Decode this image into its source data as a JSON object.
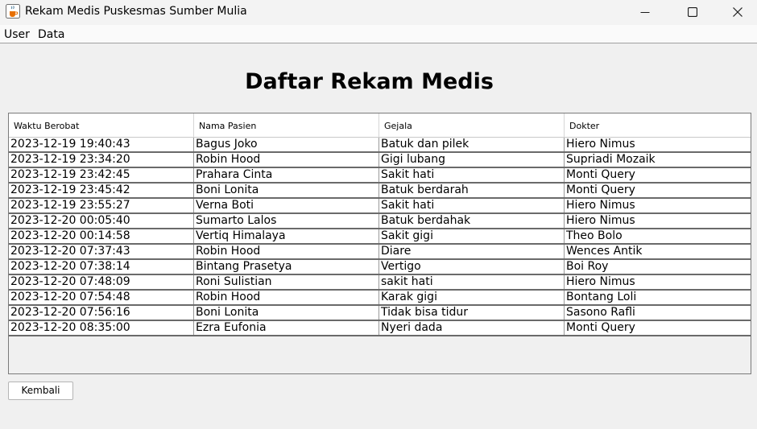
{
  "window": {
    "title": "Rekam Medis Puskesmas Sumber Mulia",
    "icons": {
      "app": "java-cup-icon",
      "minimize": "minimize-icon",
      "maximize": "maximize-icon",
      "close": "close-icon"
    }
  },
  "menu": {
    "items": [
      "User",
      "Data"
    ]
  },
  "page": {
    "title": "Daftar Rekam Medis"
  },
  "table": {
    "columns": [
      "Waktu Berobat",
      "Nama Pasien",
      "Gejala",
      "Dokter"
    ],
    "rows": [
      [
        "2023-12-19 19:40:43",
        "Bagus Joko",
        "Batuk dan pilek",
        "Hiero Nimus"
      ],
      [
        "2023-12-19 23:34:20",
        "Robin Hood",
        "Gigi lubang",
        "Supriadi Mozaik"
      ],
      [
        "2023-12-19 23:42:45",
        "Prahara Cinta",
        "Sakit hati",
        "Monti Query"
      ],
      [
        "2023-12-19 23:45:42",
        "Boni Lonita",
        "Batuk berdarah",
        "Monti Query"
      ],
      [
        "2023-12-19 23:55:27",
        "Verna Boti",
        "Sakit hati",
        "Hiero Nimus"
      ],
      [
        "2023-12-20 00:05:40",
        "Sumarto Lalos",
        "Batuk berdahak",
        "Hiero Nimus"
      ],
      [
        "2023-12-20 00:14:58",
        "Vertiq Himalaya",
        "Sakit gigi",
        "Theo Bolo"
      ],
      [
        "2023-12-20 07:37:43",
        "Robin Hood",
        "Diare",
        "Wences Antik"
      ],
      [
        "2023-12-20 07:38:14",
        "Bintang Prasetya",
        "Vertigo",
        "Boi Roy"
      ],
      [
        "2023-12-20 07:48:09",
        "Roni Sulistian",
        "sakit hati",
        "Hiero Nimus"
      ],
      [
        "2023-12-20 07:54:48",
        "Robin Hood",
        "Karak gigi",
        "Bontang Loli"
      ],
      [
        "2023-12-20 07:56:16",
        "Boni Lonita",
        "Tidak bisa tidur",
        "Sasono Rafli"
      ],
      [
        "2023-12-20 08:35:00",
        "Ezra Eufonia",
        "Nyeri dada",
        "Monti Query"
      ]
    ]
  },
  "buttons": {
    "back": "Kembali"
  }
}
